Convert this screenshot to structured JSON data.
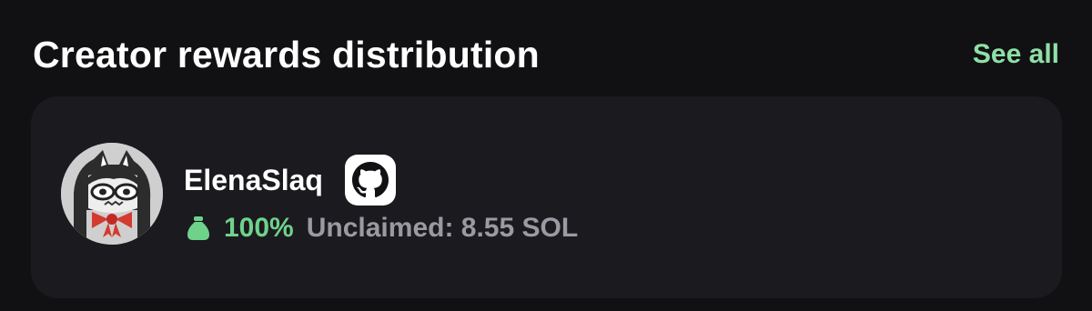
{
  "header": {
    "title": "Creator rewards distribution",
    "see_all_label": "See all"
  },
  "card": {
    "creator_name": "ElenaSlaq",
    "avatar_icon": "cat-girl-avatar",
    "badge_icon": "github-icon",
    "reward_icon": "money-bag-icon",
    "share_percent": "100%",
    "unclaimed_text": "Unclaimed: 8.55 SOL"
  },
  "colors": {
    "background": "#111114",
    "card": "#1b1a1f",
    "accent_green": "#8fe0a6",
    "percent_green": "#6fd28a",
    "muted_text": "#9b9aa2"
  }
}
